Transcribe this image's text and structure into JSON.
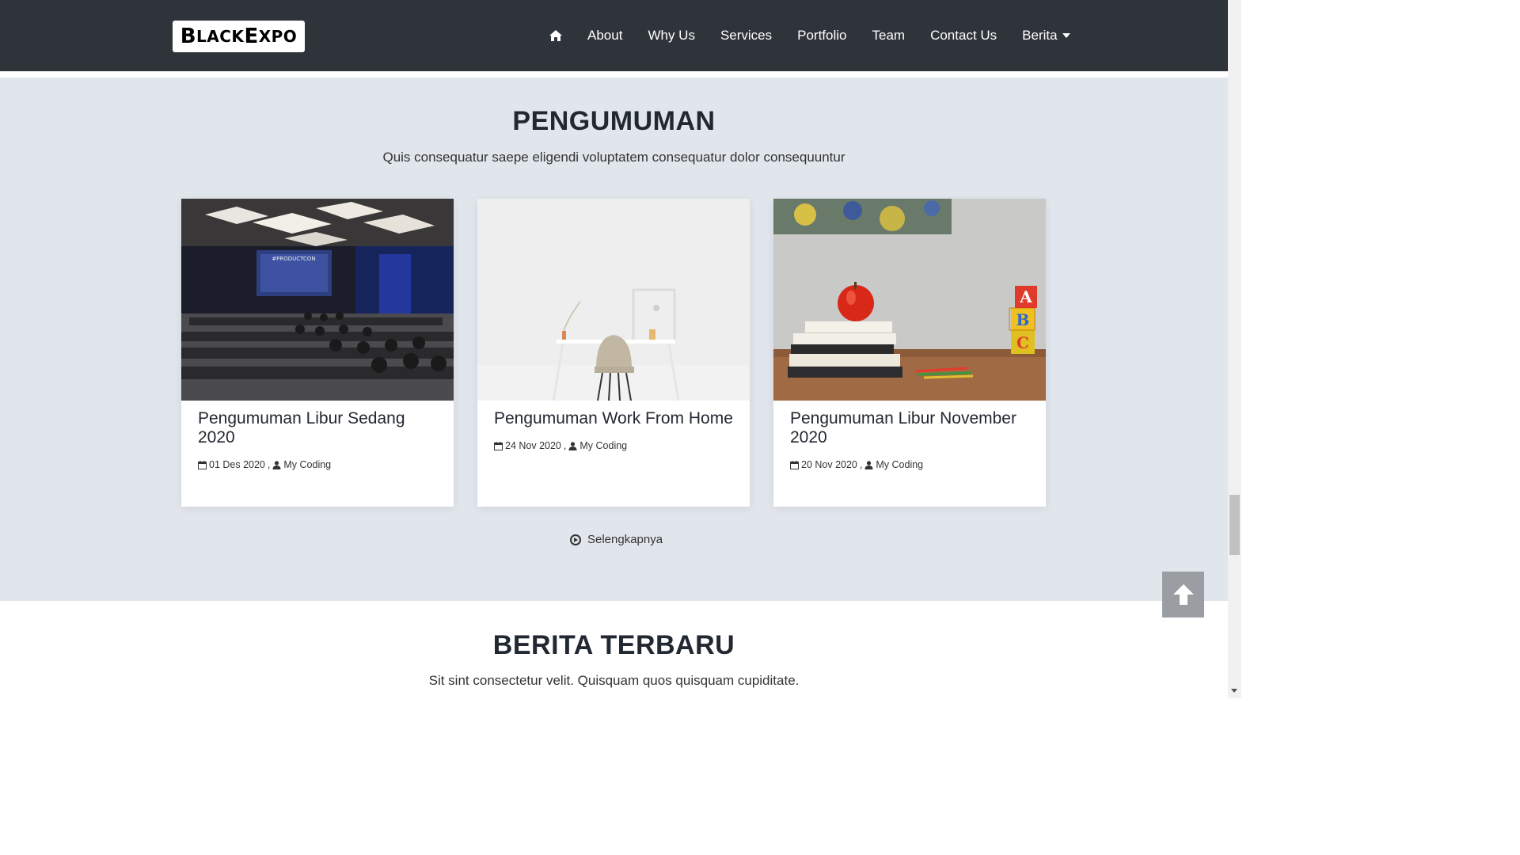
{
  "navbar": {
    "logo_text": "BlackExpo",
    "menu": [
      {
        "label": "About"
      },
      {
        "label": "Why Us"
      },
      {
        "label": "Services"
      },
      {
        "label": "Portfolio"
      },
      {
        "label": "Team"
      },
      {
        "label": "Contact Us"
      },
      {
        "label": "Berita"
      }
    ],
    "icons": {
      "home": "home-icon",
      "dropdown": "caret-down-icon"
    }
  },
  "announcements": {
    "title": "PENGUMUMAN",
    "subtitle": "Quis consequatur saepe eligendi voluptatem consequatur dolor consequuntur",
    "cards": [
      {
        "title": "Pengumuman Libur Sedang 2020",
        "date": "01 Des 2020",
        "author": "My Coding",
        "image": "conference-hall-photo"
      },
      {
        "title": "Pengumuman Work From Home",
        "date": "24 Nov 2020",
        "author": "My Coding",
        "image": "minimal-desk-chair-photo"
      },
      {
        "title": "Pengumuman Libur November 2020",
        "date": "20 Nov 2020",
        "author": "My Coding",
        "image": "apple-books-abc-blocks-photo"
      }
    ],
    "meta_separator": ",",
    "more_label": "Selengkapnya"
  },
  "news": {
    "title": "BERITA TERBARU",
    "subtitle": "Sit sint consectetur velit. Quisquam quos quisquam cupiditate."
  },
  "colors": {
    "navbar_bg": "#2f343b",
    "section_bg": "#e1e5ec",
    "back_to_top_bg": "#9a9da2"
  }
}
